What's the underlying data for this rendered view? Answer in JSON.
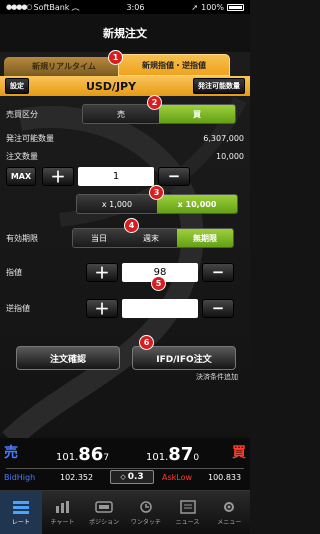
{
  "status": {
    "carrier": "SoftBank",
    "time": "3:06",
    "battery": "100%"
  },
  "title": "新規注文",
  "tabs": [
    {
      "label": "新規リアルタイム",
      "active": false
    },
    {
      "label": "新規指値・逆指値",
      "active": true
    }
  ],
  "header": {
    "settings": "設定",
    "pair": "USD/JPY",
    "orderable": "発注可能数量"
  },
  "side": {
    "label": "売買区分",
    "sell": "売",
    "buy": "買",
    "selected": "買"
  },
  "orderable_qty": {
    "label": "発注可能数量",
    "value": "6,307,000"
  },
  "order_qty": {
    "label": "注文数量",
    "value": "10,000",
    "max": "MAX",
    "input": "1"
  },
  "multiplier": {
    "options": [
      "x 1,000",
      "x 10,000"
    ],
    "selected": "x 10,000"
  },
  "expiry": {
    "label": "有効期限",
    "options": [
      "当日",
      "週末",
      "無期限"
    ],
    "selected": "無期限"
  },
  "limit": {
    "label": "指値",
    "value": "98"
  },
  "stop": {
    "label": "逆指値",
    "value": ""
  },
  "buttons": {
    "confirm": "注文確認",
    "ifd": "IFD/IFO注文",
    "add_condition": "決済条件追加"
  },
  "badges": [
    "1",
    "2",
    "3",
    "4",
    "5",
    "6"
  ],
  "quote": {
    "bid_mark": "売",
    "ask_mark": "買",
    "bid_main": "101.",
    "bid_big": "86",
    "bid_small": "7",
    "ask_main": "101.",
    "ask_big": "87",
    "ask_small": "0",
    "bid_high_label": "BidHigh",
    "bid_high": "102.352",
    "spread": "0.3",
    "ask_low_label": "AskLow",
    "ask_low": "100.833"
  },
  "nav": [
    {
      "label": "レート",
      "icon": "rate-icon",
      "active": true
    },
    {
      "label": "チャート",
      "icon": "chart-icon",
      "active": false
    },
    {
      "label": "ポジション",
      "icon": "position-icon",
      "active": false
    },
    {
      "label": "ワンタッチ",
      "icon": "onetouch-icon",
      "active": false
    },
    {
      "label": "ニュース",
      "icon": "news-icon",
      "active": false
    },
    {
      "label": "メニュー",
      "icon": "menu-icon",
      "active": false
    }
  ],
  "colors": {
    "accent": "#f0a21f",
    "buy": "#ff3b30",
    "sell": "#4a78ff",
    "selected": "#7ab828"
  }
}
